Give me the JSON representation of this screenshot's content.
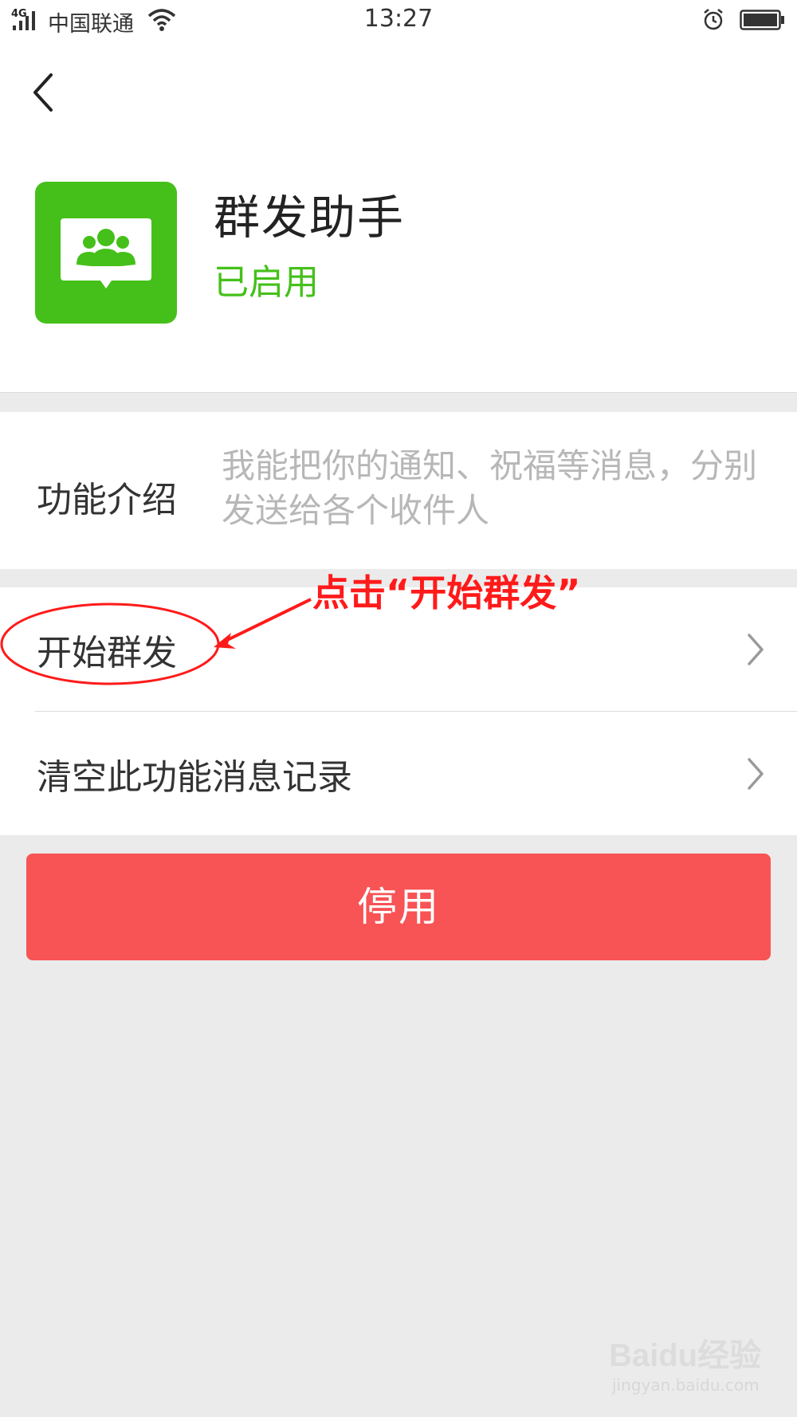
{
  "status_bar": {
    "network": "4G",
    "carrier": "中国联通",
    "time": "13:27"
  },
  "header": {
    "app_name": "群发助手",
    "app_status": "已启用",
    "accent_color": "#45c01a"
  },
  "intro": {
    "label": "功能介绍",
    "description": "我能把你的通知、祝福等消息，分别发送给各个收件人"
  },
  "menu": {
    "items": [
      {
        "label": "开始群发"
      },
      {
        "label": "清空此功能消息记录"
      }
    ]
  },
  "disable_button": {
    "label": "停用",
    "color": "#f85355"
  },
  "annotation": {
    "text": "点击“开始群发”",
    "color": "#ff1a1a"
  },
  "watermark": {
    "logo": "Baidu经验",
    "url": "jingyan.baidu.com"
  }
}
